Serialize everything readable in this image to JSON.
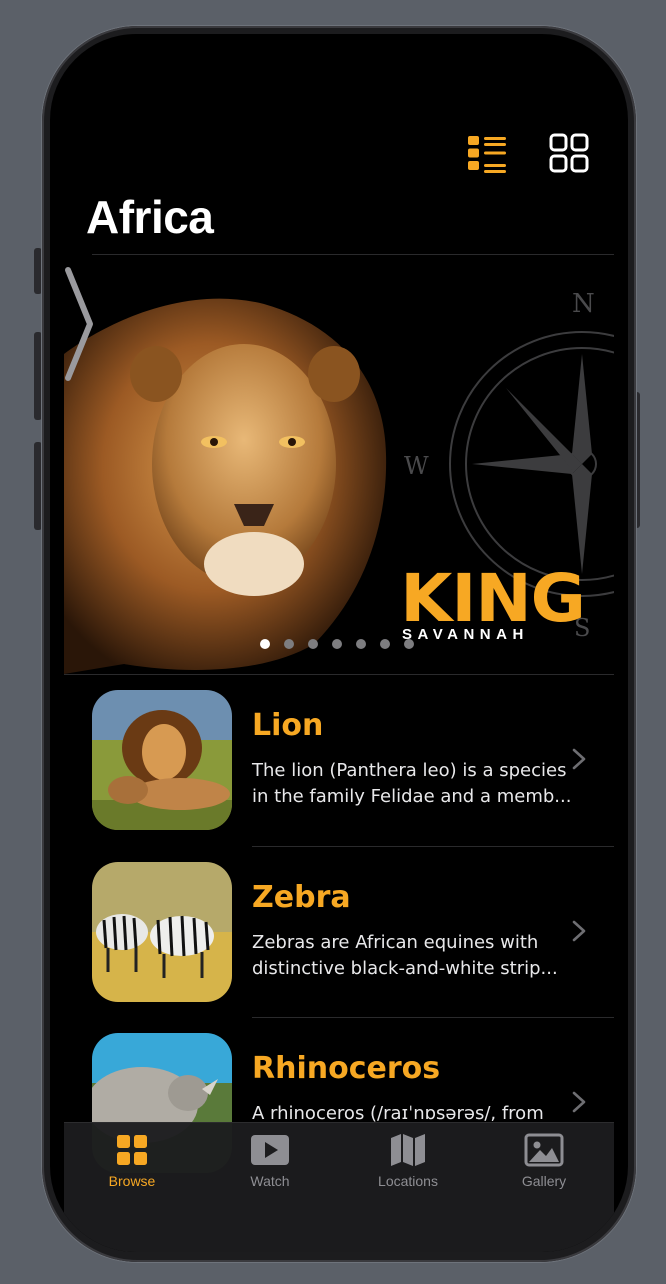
{
  "header": {
    "title": "Africa",
    "view_toggle": [
      "list-view",
      "grid-view"
    ]
  },
  "hero": {
    "headline": "KING",
    "subline": "SAVANNAH",
    "page_count": 7,
    "active_page": 1
  },
  "animals": [
    {
      "name": "Lion",
      "description": "The lion (Panthera leo) is a species in the family Felidae and a memb..."
    },
    {
      "name": "Zebra",
      "description": "Zebras are African equines with distinctive black-and-white strip..."
    },
    {
      "name": "Rhinoceros",
      "description": "A rhinoceros (/raɪˈnɒsərəs/, from"
    }
  ],
  "tabs": [
    {
      "label": "Browse",
      "icon": "grid-icon",
      "active": true
    },
    {
      "label": "Watch",
      "icon": "play-icon",
      "active": false
    },
    {
      "label": "Locations",
      "icon": "map-icon",
      "active": false
    },
    {
      "label": "Gallery",
      "icon": "photo-icon",
      "active": false
    }
  ],
  "colors": {
    "accent": "#f7a823",
    "background": "#000000",
    "text": "#ffffff"
  }
}
